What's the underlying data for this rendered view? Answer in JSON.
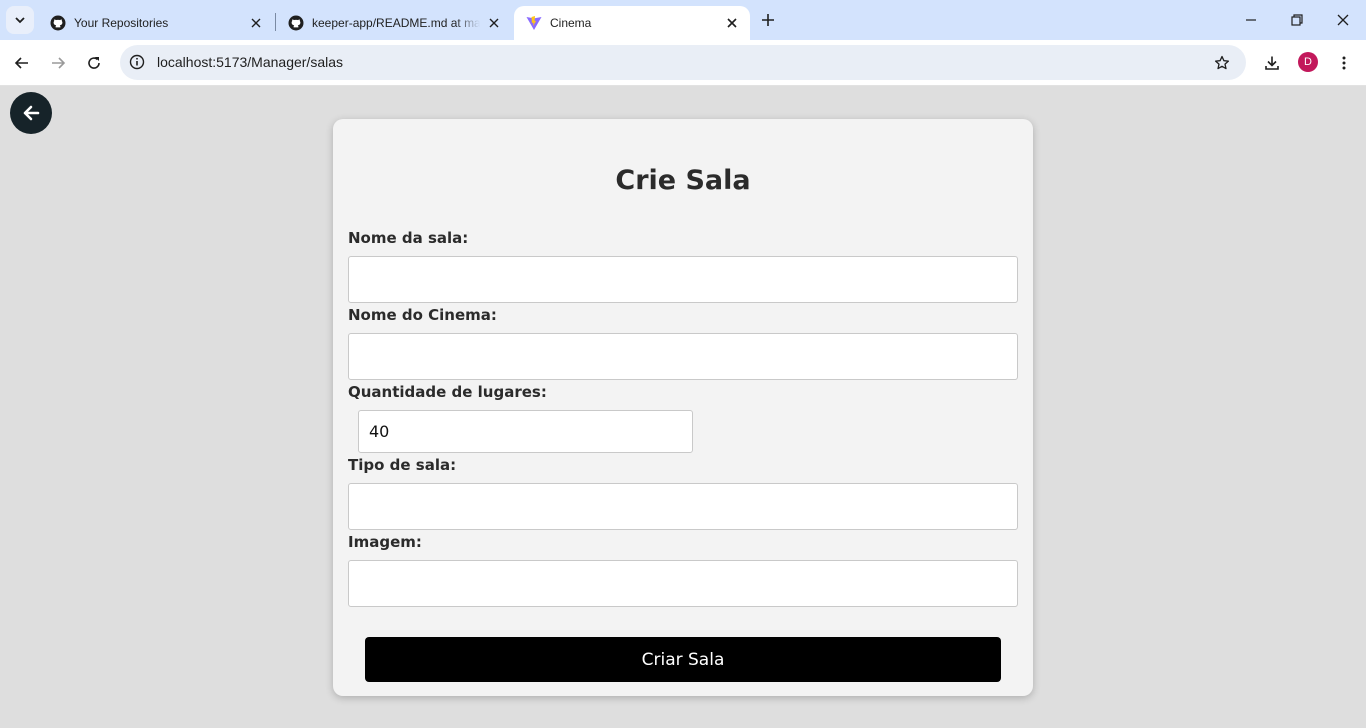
{
  "browser": {
    "tabs": [
      {
        "title": "Your Repositories",
        "favicon": "github-icon"
      },
      {
        "title": "keeper-app/README.md at main",
        "favicon": "github-icon"
      },
      {
        "title": "Cinema",
        "favicon": "vite-icon",
        "active": true
      }
    ],
    "url": "localhost:5173/Manager/salas",
    "profile_initial": "D"
  },
  "page": {
    "title": "Crie Sala",
    "fields": {
      "nome_sala": {
        "label": "Nome da sala:",
        "value": ""
      },
      "nome_cinema": {
        "label": "Nome do Cinema:",
        "value": ""
      },
      "quantidade": {
        "label": "Quantidade de lugares:",
        "value": "40"
      },
      "tipo": {
        "label": "Tipo de sala:",
        "value": ""
      },
      "imagem": {
        "label": "Imagem:",
        "value": ""
      }
    },
    "submit_label": "Criar Sala"
  },
  "colors": {
    "background": "#dedede",
    "card": "#f3f3f3",
    "button": "#000000",
    "back_button": "#162329",
    "tabstrip": "#d3e3fd"
  }
}
